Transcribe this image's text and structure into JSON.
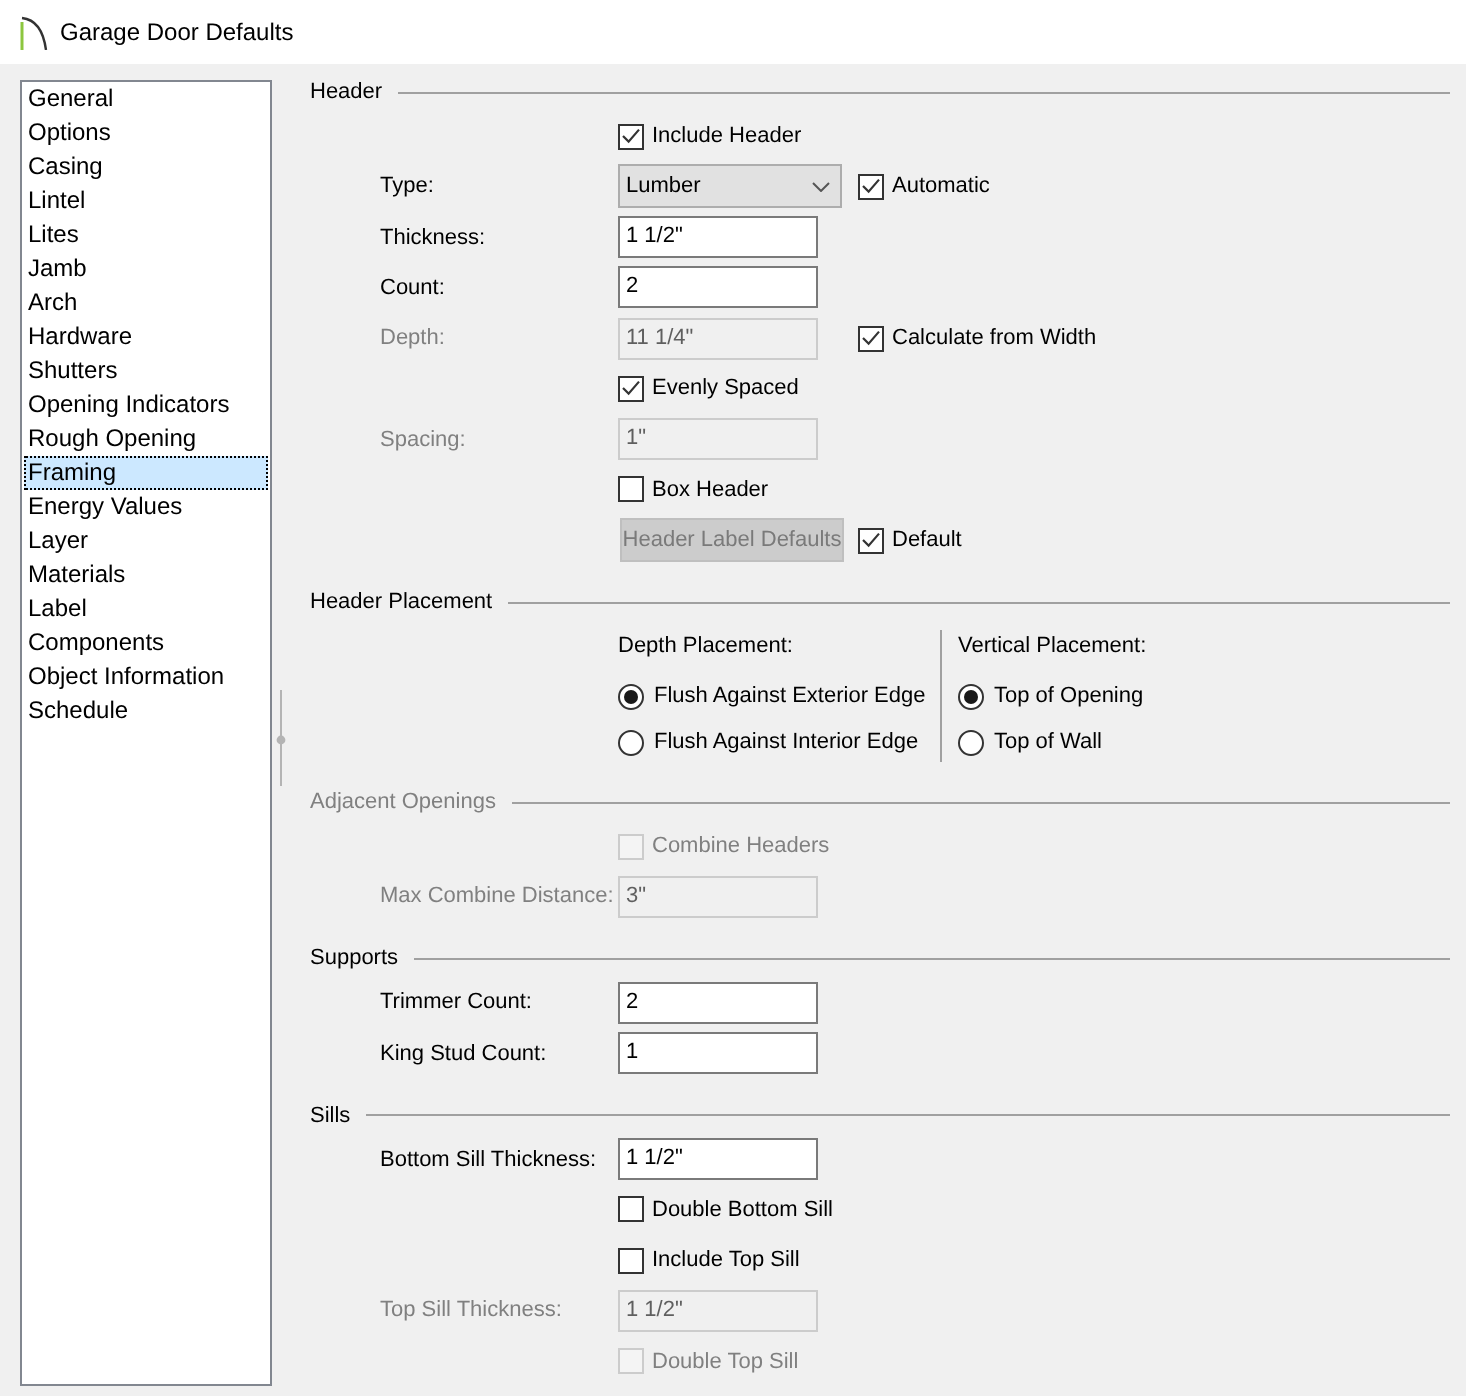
{
  "window": {
    "title": "Garage Door Defaults"
  },
  "sidebar": {
    "items": [
      {
        "label": "General",
        "selected": false
      },
      {
        "label": "Options",
        "selected": false
      },
      {
        "label": "Casing",
        "selected": false
      },
      {
        "label": "Lintel",
        "selected": false
      },
      {
        "label": "Lites",
        "selected": false
      },
      {
        "label": "Jamb",
        "selected": false
      },
      {
        "label": "Arch",
        "selected": false
      },
      {
        "label": "Hardware",
        "selected": false
      },
      {
        "label": "Shutters",
        "selected": false
      },
      {
        "label": "Opening Indicators",
        "selected": false
      },
      {
        "label": "Rough Opening",
        "selected": false
      },
      {
        "label": "Framing",
        "selected": true
      },
      {
        "label": "Energy Values",
        "selected": false
      },
      {
        "label": "Layer",
        "selected": false
      },
      {
        "label": "Materials",
        "selected": false
      },
      {
        "label": "Label",
        "selected": false
      },
      {
        "label": "Components",
        "selected": false
      },
      {
        "label": "Object Information",
        "selected": false
      },
      {
        "label": "Schedule",
        "selected": false
      }
    ]
  },
  "sections": [
    {
      "title": "Header",
      "disabled": false,
      "rows": [
        {
          "kind": "checkbox",
          "label": "Include Header",
          "checked": true,
          "disabled": false
        },
        {
          "kind": "dropdown",
          "label": "Type:",
          "value": "Lumber",
          "disabled": false,
          "side": {
            "label": "Automatic",
            "checked": true
          }
        },
        {
          "kind": "field",
          "label": "Thickness:",
          "value": "1 1/2\"",
          "disabled": false
        },
        {
          "kind": "field",
          "label": "Count:",
          "value": "2",
          "disabled": false
        },
        {
          "kind": "field",
          "label": "Depth:",
          "value": "11 1/4\"",
          "disabled": true,
          "side": {
            "label": "Calculate from Width",
            "checked": true
          }
        },
        {
          "kind": "checkbox",
          "label": "Evenly Spaced",
          "checked": true,
          "disabled": false
        },
        {
          "kind": "field",
          "label": "Spacing:",
          "value": "1\"",
          "disabled": true
        },
        {
          "kind": "checkbox",
          "label": "Box Header",
          "checked": false,
          "disabled": false
        },
        {
          "kind": "button",
          "label": "Header Label Defaults",
          "disabled": true,
          "side": {
            "label": "Default",
            "checked": true
          }
        }
      ]
    },
    {
      "title": "Header Placement",
      "disabled": false,
      "rows": [
        {
          "kind": "radio_groups",
          "disabled": false,
          "groups": [
            {
              "title": "Depth Placement:",
              "options": [
                {
                  "label": "Flush Against Exterior Edge",
                  "selected": true
                },
                {
                  "label": "Flush Against Interior Edge",
                  "selected": false
                }
              ]
            },
            {
              "title": "Vertical Placement:",
              "options": [
                {
                  "label": "Top of Opening",
                  "selected": true
                },
                {
                  "label": "Top of Wall",
                  "selected": false
                }
              ]
            }
          ]
        }
      ]
    },
    {
      "title": "Adjacent Openings",
      "disabled": true,
      "rows": [
        {
          "kind": "checkbox",
          "label": "Combine Headers",
          "checked": false,
          "disabled": true
        },
        {
          "kind": "field",
          "label": "Max Combine Distance:",
          "value": "3\"",
          "disabled": true
        }
      ]
    },
    {
      "title": "Supports",
      "disabled": false,
      "rows": [
        {
          "kind": "field",
          "label": "Trimmer Count:",
          "value": "2",
          "disabled": false
        },
        {
          "kind": "field",
          "label": "King Stud Count:",
          "value": "1",
          "disabled": false
        }
      ]
    },
    {
      "title": "Sills",
      "disabled": false,
      "rows": [
        {
          "kind": "field",
          "label": "Bottom Sill Thickness:",
          "value": "1 1/2\"",
          "disabled": false
        },
        {
          "kind": "checkbox",
          "label": "Double Bottom Sill",
          "checked": false,
          "disabled": false
        },
        {
          "kind": "checkbox",
          "label": "Include Top Sill",
          "checked": false,
          "disabled": false
        },
        {
          "kind": "field",
          "label": "Top Sill Thickness:",
          "value": "1 1/2\"",
          "disabled": true
        },
        {
          "kind": "checkbox",
          "label": "Double Top Sill",
          "checked": false,
          "disabled": true
        }
      ]
    }
  ]
}
